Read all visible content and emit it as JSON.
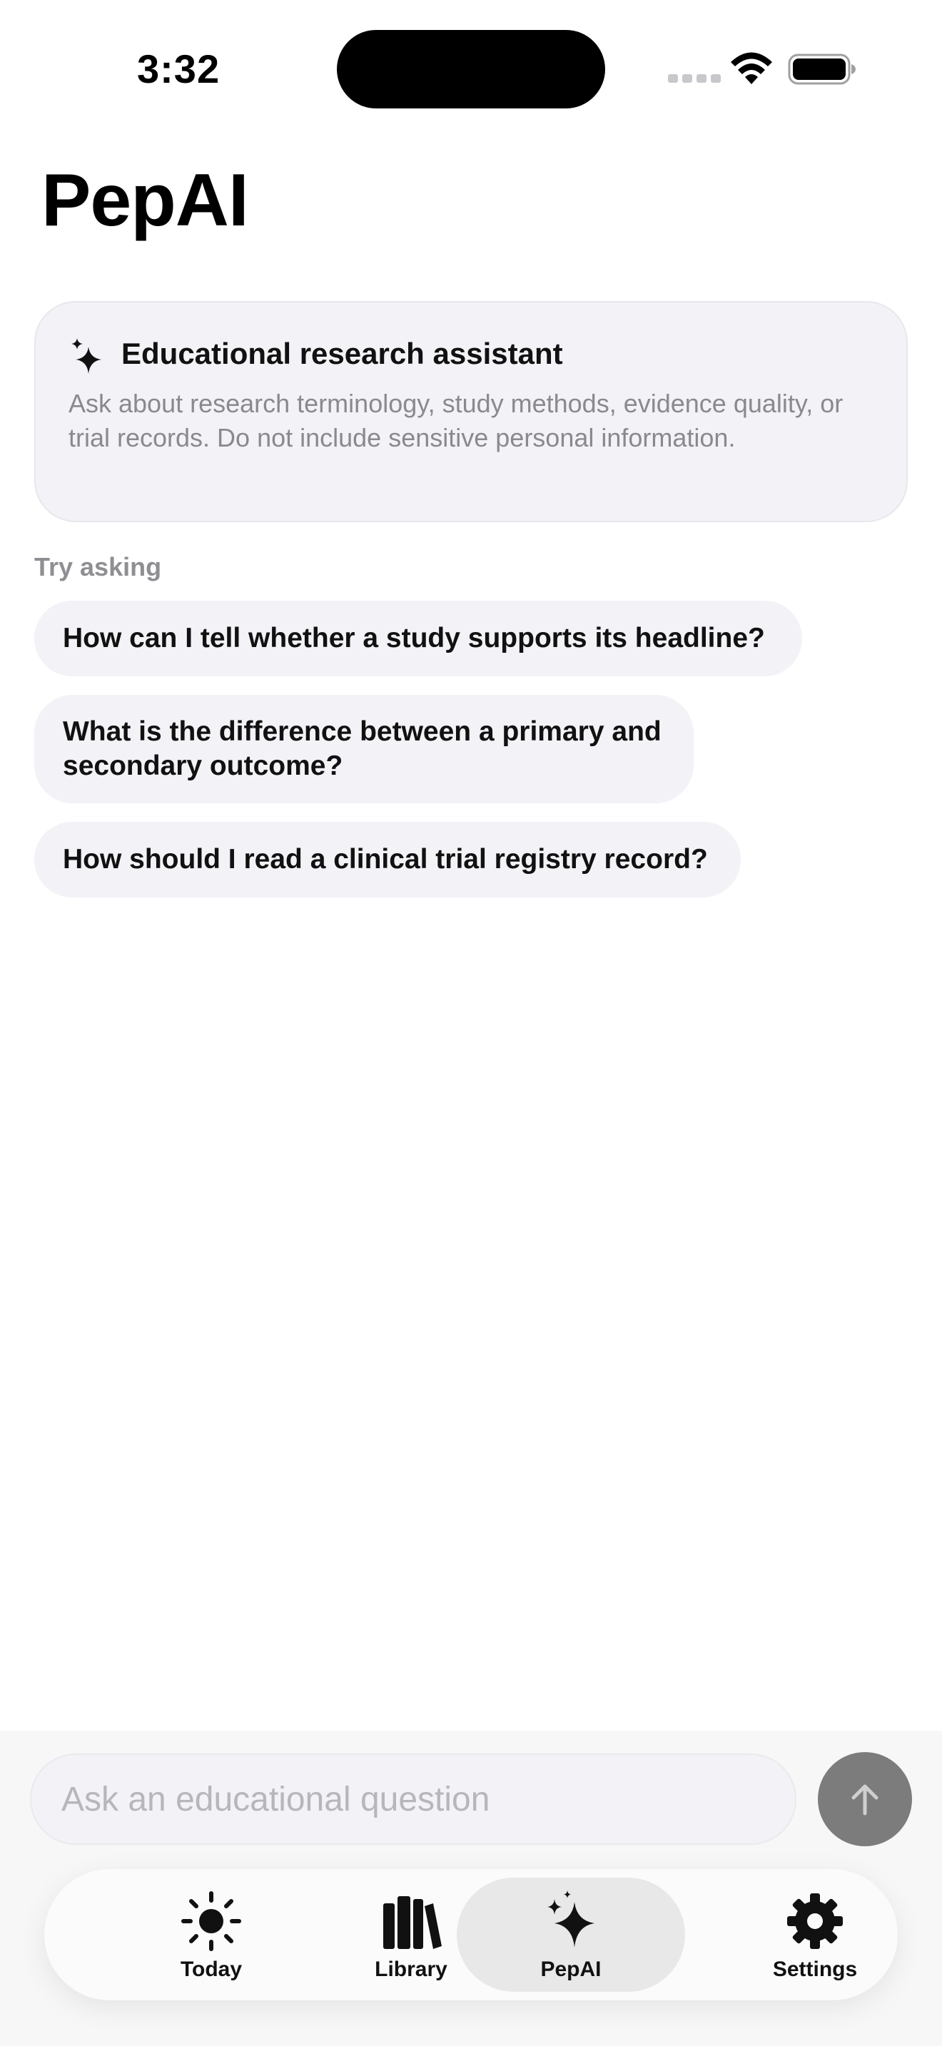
{
  "status_bar": {
    "time": "3:32"
  },
  "page": {
    "title": "PepAI"
  },
  "info_card": {
    "icon": "sparkles-icon",
    "title": "Educational research assistant",
    "body": "Ask about research terminology, study methods, evidence quality, or trial records. Do not include sensitive personal information."
  },
  "suggestions": {
    "label": "Try asking",
    "items": [
      "How can I tell whether a study supports its headline?",
      "What is the difference between a primary and secondary outcome?",
      "How should I read a clinical trial registry record?"
    ]
  },
  "composer": {
    "placeholder": "Ask an educational question",
    "send_icon": "arrow-up-icon"
  },
  "tab_bar": {
    "active": "PepAI",
    "items": [
      {
        "label": "Today",
        "icon": "sun-icon"
      },
      {
        "label": "Library",
        "icon": "books-icon"
      },
      {
        "label": "PepAI",
        "icon": "sparkles-icon"
      },
      {
        "label": "Settings",
        "icon": "gear-icon"
      }
    ]
  }
}
